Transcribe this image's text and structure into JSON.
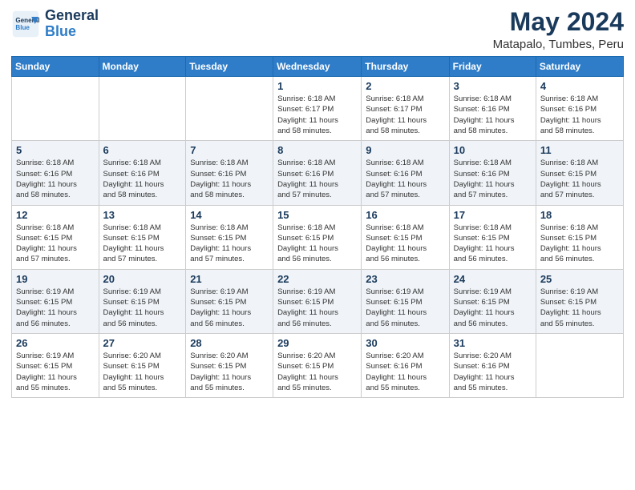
{
  "header": {
    "logo_line1": "General",
    "logo_line2": "Blue",
    "month": "May 2024",
    "location": "Matapalo, Tumbes, Peru"
  },
  "weekdays": [
    "Sunday",
    "Monday",
    "Tuesday",
    "Wednesday",
    "Thursday",
    "Friday",
    "Saturday"
  ],
  "weeks": [
    [
      {
        "day": "",
        "info": ""
      },
      {
        "day": "",
        "info": ""
      },
      {
        "day": "",
        "info": ""
      },
      {
        "day": "1",
        "info": "Sunrise: 6:18 AM\nSunset: 6:17 PM\nDaylight: 11 hours\nand 58 minutes."
      },
      {
        "day": "2",
        "info": "Sunrise: 6:18 AM\nSunset: 6:17 PM\nDaylight: 11 hours\nand 58 minutes."
      },
      {
        "day": "3",
        "info": "Sunrise: 6:18 AM\nSunset: 6:16 PM\nDaylight: 11 hours\nand 58 minutes."
      },
      {
        "day": "4",
        "info": "Sunrise: 6:18 AM\nSunset: 6:16 PM\nDaylight: 11 hours\nand 58 minutes."
      }
    ],
    [
      {
        "day": "5",
        "info": "Sunrise: 6:18 AM\nSunset: 6:16 PM\nDaylight: 11 hours\nand 58 minutes."
      },
      {
        "day": "6",
        "info": "Sunrise: 6:18 AM\nSunset: 6:16 PM\nDaylight: 11 hours\nand 58 minutes."
      },
      {
        "day": "7",
        "info": "Sunrise: 6:18 AM\nSunset: 6:16 PM\nDaylight: 11 hours\nand 58 minutes."
      },
      {
        "day": "8",
        "info": "Sunrise: 6:18 AM\nSunset: 6:16 PM\nDaylight: 11 hours\nand 57 minutes."
      },
      {
        "day": "9",
        "info": "Sunrise: 6:18 AM\nSunset: 6:16 PM\nDaylight: 11 hours\nand 57 minutes."
      },
      {
        "day": "10",
        "info": "Sunrise: 6:18 AM\nSunset: 6:16 PM\nDaylight: 11 hours\nand 57 minutes."
      },
      {
        "day": "11",
        "info": "Sunrise: 6:18 AM\nSunset: 6:15 PM\nDaylight: 11 hours\nand 57 minutes."
      }
    ],
    [
      {
        "day": "12",
        "info": "Sunrise: 6:18 AM\nSunset: 6:15 PM\nDaylight: 11 hours\nand 57 minutes."
      },
      {
        "day": "13",
        "info": "Sunrise: 6:18 AM\nSunset: 6:15 PM\nDaylight: 11 hours\nand 57 minutes."
      },
      {
        "day": "14",
        "info": "Sunrise: 6:18 AM\nSunset: 6:15 PM\nDaylight: 11 hours\nand 57 minutes."
      },
      {
        "day": "15",
        "info": "Sunrise: 6:18 AM\nSunset: 6:15 PM\nDaylight: 11 hours\nand 56 minutes."
      },
      {
        "day": "16",
        "info": "Sunrise: 6:18 AM\nSunset: 6:15 PM\nDaylight: 11 hours\nand 56 minutes."
      },
      {
        "day": "17",
        "info": "Sunrise: 6:18 AM\nSunset: 6:15 PM\nDaylight: 11 hours\nand 56 minutes."
      },
      {
        "day": "18",
        "info": "Sunrise: 6:18 AM\nSunset: 6:15 PM\nDaylight: 11 hours\nand 56 minutes."
      }
    ],
    [
      {
        "day": "19",
        "info": "Sunrise: 6:19 AM\nSunset: 6:15 PM\nDaylight: 11 hours\nand 56 minutes."
      },
      {
        "day": "20",
        "info": "Sunrise: 6:19 AM\nSunset: 6:15 PM\nDaylight: 11 hours\nand 56 minutes."
      },
      {
        "day": "21",
        "info": "Sunrise: 6:19 AM\nSunset: 6:15 PM\nDaylight: 11 hours\nand 56 minutes."
      },
      {
        "day": "22",
        "info": "Sunrise: 6:19 AM\nSunset: 6:15 PM\nDaylight: 11 hours\nand 56 minutes."
      },
      {
        "day": "23",
        "info": "Sunrise: 6:19 AM\nSunset: 6:15 PM\nDaylight: 11 hours\nand 56 minutes."
      },
      {
        "day": "24",
        "info": "Sunrise: 6:19 AM\nSunset: 6:15 PM\nDaylight: 11 hours\nand 56 minutes."
      },
      {
        "day": "25",
        "info": "Sunrise: 6:19 AM\nSunset: 6:15 PM\nDaylight: 11 hours\nand 55 minutes."
      }
    ],
    [
      {
        "day": "26",
        "info": "Sunrise: 6:19 AM\nSunset: 6:15 PM\nDaylight: 11 hours\nand 55 minutes."
      },
      {
        "day": "27",
        "info": "Sunrise: 6:20 AM\nSunset: 6:15 PM\nDaylight: 11 hours\nand 55 minutes."
      },
      {
        "day": "28",
        "info": "Sunrise: 6:20 AM\nSunset: 6:15 PM\nDaylight: 11 hours\nand 55 minutes."
      },
      {
        "day": "29",
        "info": "Sunrise: 6:20 AM\nSunset: 6:15 PM\nDaylight: 11 hours\nand 55 minutes."
      },
      {
        "day": "30",
        "info": "Sunrise: 6:20 AM\nSunset: 6:16 PM\nDaylight: 11 hours\nand 55 minutes."
      },
      {
        "day": "31",
        "info": "Sunrise: 6:20 AM\nSunset: 6:16 PM\nDaylight: 11 hours\nand 55 minutes."
      },
      {
        "day": "",
        "info": ""
      }
    ]
  ]
}
